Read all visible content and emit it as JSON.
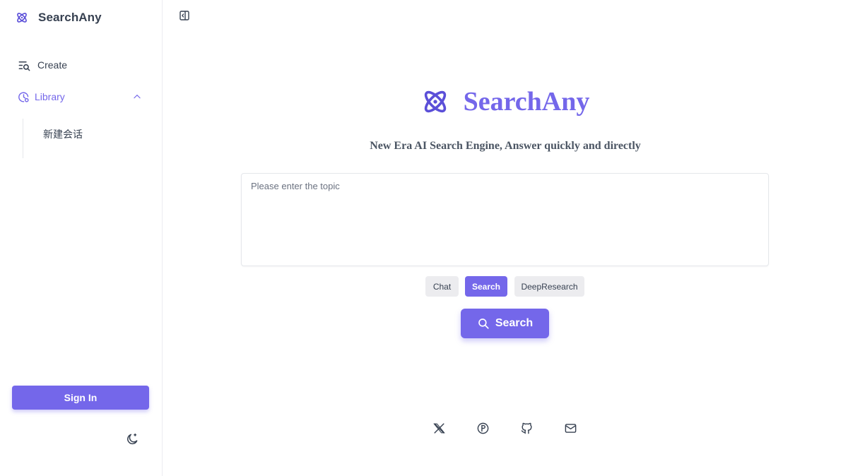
{
  "app": {
    "name": "SearchAny"
  },
  "sidebar": {
    "create_label": "Create",
    "library_label": "Library",
    "library_items": [
      "新建会话"
    ],
    "signin_label": "Sign In"
  },
  "hero": {
    "title": "SearchAny",
    "tagline": "New Era AI Search Engine, Answer quickly and directly"
  },
  "search": {
    "placeholder": "Please enter the topic",
    "value": "",
    "modes": [
      "Chat",
      "Search",
      "DeepResearch"
    ],
    "selected_mode": "Search",
    "button_label": "Search"
  },
  "social": [
    "x-icon",
    "producthunt-icon",
    "github-icon",
    "mail-icon"
  ],
  "colors": {
    "accent": "#7467ea",
    "chip_bg": "#ececef"
  }
}
